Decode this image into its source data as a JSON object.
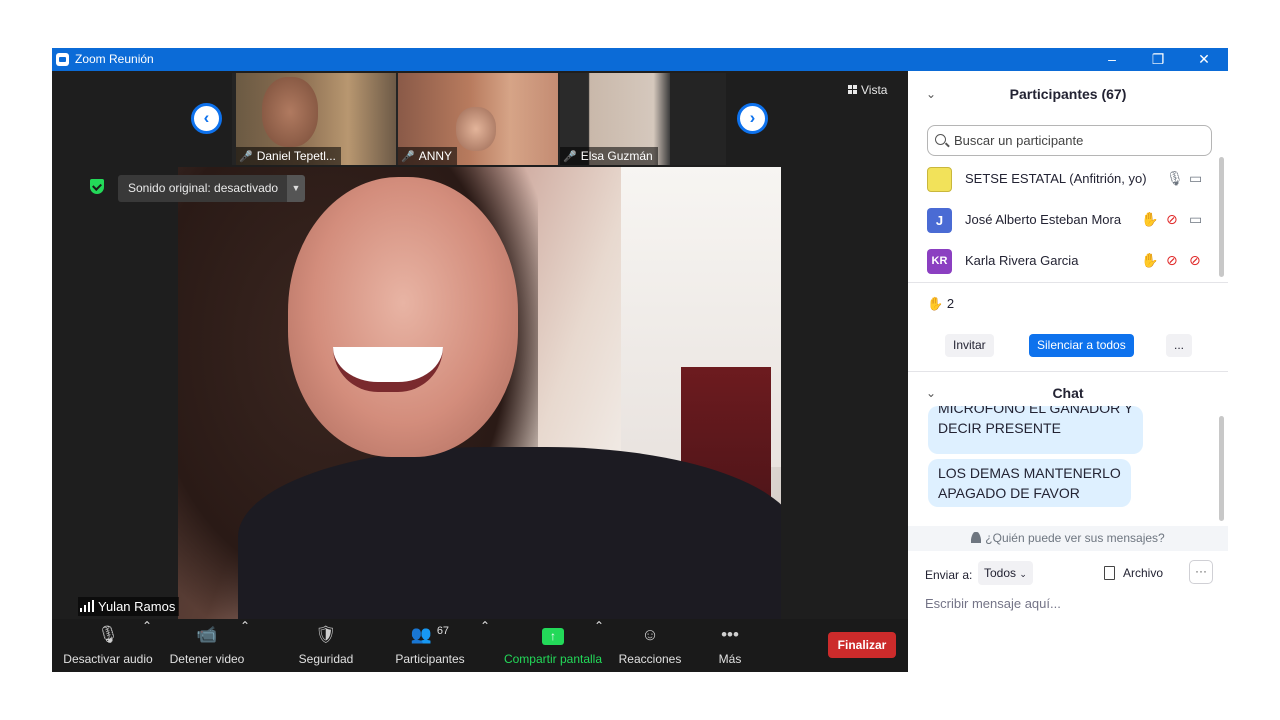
{
  "window": {
    "title": "Zoom Reunión",
    "controls": [
      "–",
      "❐",
      "✕"
    ]
  },
  "video": {
    "thumbnails": [
      {
        "name": "Daniel Tepetl..."
      },
      {
        "name": "ANNY"
      },
      {
        "name": "Elsa Guzmán"
      }
    ],
    "view_label": "Vista",
    "sound_original": "Sonido original: desactivado",
    "speaker_name": "Yulan Ramos"
  },
  "toolbar": {
    "mute": "Desactivar audio",
    "stop_video": "Detener video",
    "security": "Seguridad",
    "participants": "Participantes",
    "participants_count": "67",
    "share": "Compartir pantalla",
    "reactions": "Reacciones",
    "more": "Más",
    "end": "Finalizar"
  },
  "participants_panel": {
    "title": "Participantes (67)",
    "search_placeholder": "Buscar un participante",
    "rows": [
      {
        "name": "SETSE ESTATAL (Anfitrión, yo)",
        "avatar": "",
        "avatar_color": "#f2e25a"
      },
      {
        "name": "José Alberto Esteban Mora",
        "avatar": "J",
        "avatar_color": "#4a6bd4"
      },
      {
        "name": "Karla Rivera Garcia",
        "avatar": "KR",
        "avatar_color": "#8b3fc1"
      }
    ],
    "raised_hands": "2",
    "invite": "Invitar",
    "mute_all": "Silenciar a todos",
    "more": "..."
  },
  "chat_panel": {
    "title": "Chat",
    "messages": [
      {
        "line1": "MICROFONO EL GANADOR Y",
        "line2": "DECIR PRESENTE"
      },
      {
        "line1": "LOS DEMAS MANTENERLO",
        "line2": "APAGADO DE FAVOR"
      }
    ],
    "visibility": "¿Quién puede ver sus mensajes?",
    "send_to_label": "Enviar a:",
    "send_to_value": "Todos",
    "file": "Archivo",
    "more": "···",
    "input_placeholder": "Escribir mensaje aquí..."
  }
}
